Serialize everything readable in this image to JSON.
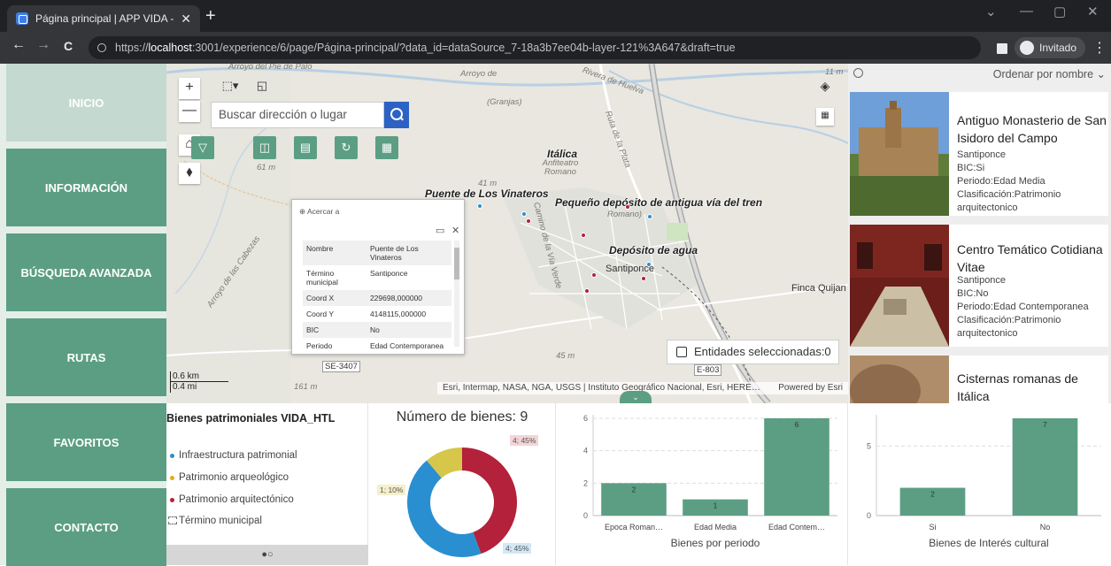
{
  "browser": {
    "tab_title": "Página principal | APP VIDA - HTL IF",
    "tab_close": "✕",
    "new_tab": "+",
    "url_prefix": "https://",
    "url_host": "localhost",
    "url_rest": ":3001/experience/6/page/Página-principal/?data_id=dataSource_7-18a3b7ee04b-layer-121%3A647&draft=true",
    "profile_label": "Invitado",
    "back": "←",
    "forward": "→",
    "reload": "C",
    "menu": "⋮",
    "win_min": "—",
    "win_max": "▢",
    "win_close": "✕",
    "win_down": "⌄"
  },
  "sidebar": {
    "items": [
      {
        "label": "INICIO"
      },
      {
        "label": "INFORMACIÓN"
      },
      {
        "label": "BÚSQUEDA AVANZADA"
      },
      {
        "label": "RUTAS"
      },
      {
        "label": "FAVORITOS"
      },
      {
        "label": "CONTACTO"
      }
    ]
  },
  "map": {
    "search_placeholder": "Buscar dirección o lugar",
    "zoom_in": "+",
    "zoom_out": "—",
    "home": "⌂",
    "compass": "⬧",
    "layers": "◈",
    "labels": {
      "italica": "Itálica",
      "anfiteatro": "Anfiteatro Romano",
      "puente": "Puente de Los Vinateros",
      "deposito_via": "Pequeño depósito de antigua vía del tren",
      "deposito_agua": "Depósito de agua",
      "romano": "Romano)",
      "santiponce": "Santiponce",
      "finca": "Finca Quijan",
      "granjas": "(Granjas)",
      "arroyo1": "Arroyo del Pie de Palo",
      "arroyo2": "Arroyo de",
      "rivera": "Rivera de Huelva",
      "ruta": "Ruta de la Plata",
      "cabezas": "Arroyo de las Cabezas",
      "via_verde": "Camino de la Vía Verde",
      "m41": "41 m",
      "m61": "61 m",
      "m45": "45 m",
      "m161": "161 m",
      "se3407": "SE-3407",
      "e803": "E-803",
      "m11": "11 m"
    },
    "popup": {
      "zoom_to": "⊕ Acercar a",
      "rows": [
        {
          "k": "Nombre",
          "v": "Puente de Los Vinateros"
        },
        {
          "k": "Término municipal",
          "v": "Santiponce"
        },
        {
          "k": "Coord X",
          "v": "229698,000000"
        },
        {
          "k": "Coord Y",
          "v": "4148115,000000"
        },
        {
          "k": "BIC",
          "v": "No"
        },
        {
          "k": "Periodo",
          "v": "Edad Contemporanea"
        }
      ]
    },
    "selected": "Entidades seleccionadas:0",
    "attribution": "Esri, Intermap, NASA, NGA, USGS | Instituto Geográfico Nacional, Esri, HERE…",
    "powered": "Powered by Esri",
    "scale_km": "0.6 km",
    "scale_mi": "0.4 mi"
  },
  "list": {
    "sort_label": "Ordenar por nombre ⌄",
    "items": [
      {
        "title": "Antiguo Monasterio de San Isidoro del Campo",
        "municipio": "Santiponce",
        "bic": "BIC:Si",
        "periodo": "Periodo:Edad Media",
        "clasificacion": "Clasificación:Patrimonio arquitectonico"
      },
      {
        "title": "Centro Temático Cotidiana Vitae",
        "municipio": "Santiponce",
        "bic": "BIC:No",
        "periodo": "Periodo:Edad Contemporanea",
        "clasificacion": "Clasificación:Patrimonio arquitectonico"
      },
      {
        "title": "Cisternas romanas de Itálica"
      }
    ]
  },
  "legend": {
    "title": "Bienes patrimoniales VIDA_HTL",
    "items": [
      {
        "label": "Infraestructura patrimonial",
        "color": "#2a8fd0"
      },
      {
        "label": "Patrimonio arqueológico",
        "color": "#e5a820"
      },
      {
        "label": "Patrimonio arquitectónico",
        "color": "#b3213a"
      },
      {
        "label": "Término municipal"
      }
    ],
    "pager": "●○"
  },
  "chart_data": [
    {
      "type": "pie",
      "title": "Número de bienes: 9",
      "categories": [
        "Patrimonio arquitectónico",
        "Infraestructura patrimonial",
        "Patrimonio arqueológico"
      ],
      "values": [
        4,
        4,
        1
      ],
      "labels": [
        "4; 45%",
        "4; 45%",
        "1; 10%"
      ],
      "colors": [
        "#b3213a",
        "#2a8fd0",
        "#d6c64a"
      ]
    },
    {
      "type": "bar",
      "categories": [
        "Epoca Roman…",
        "Edad Media",
        "Edad Contem…"
      ],
      "values": [
        2,
        1,
        6
      ],
      "xlabel": "Bienes por periodo",
      "ylabel": "",
      "ylim": [
        0,
        6
      ],
      "yticks": [
        0,
        2,
        4,
        6
      ],
      "color": "#5b9e84"
    },
    {
      "type": "bar",
      "categories": [
        "Si",
        "No"
      ],
      "values": [
        2,
        7
      ],
      "xlabel": "Bienes de Interés cultural",
      "ylabel": "",
      "ylim": [
        0,
        7
      ],
      "yticks": [
        0,
        5
      ],
      "color": "#5b9e84"
    }
  ]
}
